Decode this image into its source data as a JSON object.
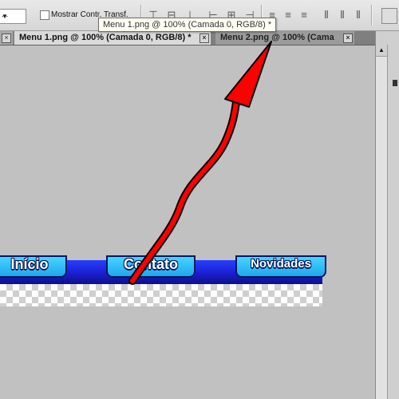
{
  "options_bar": {
    "dropdown_value": "...",
    "show_transform_label": "Mostrar Contr. Transf."
  },
  "tooltip": {
    "text": "Menu 1.png @ 100% (Camada 0, RGB/8) *"
  },
  "tabs": [
    {
      "label": "Menu 1.png @ 100% (Camada 0, RGB/8) *",
      "active": true
    },
    {
      "label": "Menu 2.png @ 100% (Cama",
      "active": false
    }
  ],
  "canvas": {
    "menu_buttons": [
      "Início",
      "Contato",
      "Novidades"
    ]
  },
  "annotation": {
    "arrow_color": "#ff0000"
  },
  "colors": {
    "menu_band": "#1a1fcf",
    "menu_button": "#2bb6f2"
  }
}
